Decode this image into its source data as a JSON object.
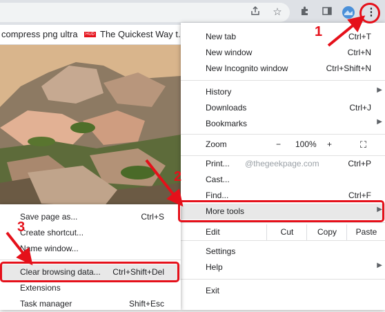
{
  "toolbar": {
    "icons": [
      "share-icon",
      "star-icon",
      "extensions-icon",
      "side-panel-icon",
      "profile-avatar",
      "kebab-menu-icon"
    ]
  },
  "bookmarks": [
    {
      "label": "compress png ultra"
    },
    {
      "badge": "HUD",
      "label": "The Quickest Way t..."
    }
  ],
  "menu": {
    "new_tab": {
      "label": "New tab",
      "shortcut": "Ctrl+T"
    },
    "new_window": {
      "label": "New window",
      "shortcut": "Ctrl+N"
    },
    "new_incognito": {
      "label": "New Incognito window",
      "shortcut": "Ctrl+Shift+N"
    },
    "history": {
      "label": "History"
    },
    "downloads": {
      "label": "Downloads",
      "shortcut": "Ctrl+J"
    },
    "bookmarks": {
      "label": "Bookmarks"
    },
    "zoom": {
      "label": "Zoom",
      "minus": "−",
      "value": "100%",
      "plus": "+"
    },
    "print": {
      "label": "Print...",
      "shortcut": "Ctrl+P"
    },
    "cast": {
      "label": "Cast..."
    },
    "find": {
      "label": "Find...",
      "shortcut": "Ctrl+F"
    },
    "more_tools": {
      "label": "More tools"
    },
    "edit": {
      "label": "Edit",
      "cut": "Cut",
      "copy": "Copy",
      "paste": "Paste"
    },
    "settings": {
      "label": "Settings"
    },
    "help": {
      "label": "Help"
    },
    "exit": {
      "label": "Exit"
    }
  },
  "watermark": "@thegeekpage.com",
  "submenu": {
    "save_page": {
      "label": "Save page as...",
      "shortcut": "Ctrl+S"
    },
    "create_shortcut": {
      "label": "Create shortcut..."
    },
    "name_window": {
      "label": "Name window..."
    },
    "clear_browsing": {
      "label": "Clear browsing data...",
      "shortcut": "Ctrl+Shift+Del"
    },
    "extensions": {
      "label": "Extensions"
    },
    "task_manager": {
      "label": "Task manager",
      "shortcut": "Shift+Esc"
    }
  },
  "annotations": {
    "step1": "1",
    "step2": "2",
    "step3": "3"
  },
  "colors": {
    "annotation_red": "#e5101a",
    "highlight": "#e8e8e8"
  }
}
